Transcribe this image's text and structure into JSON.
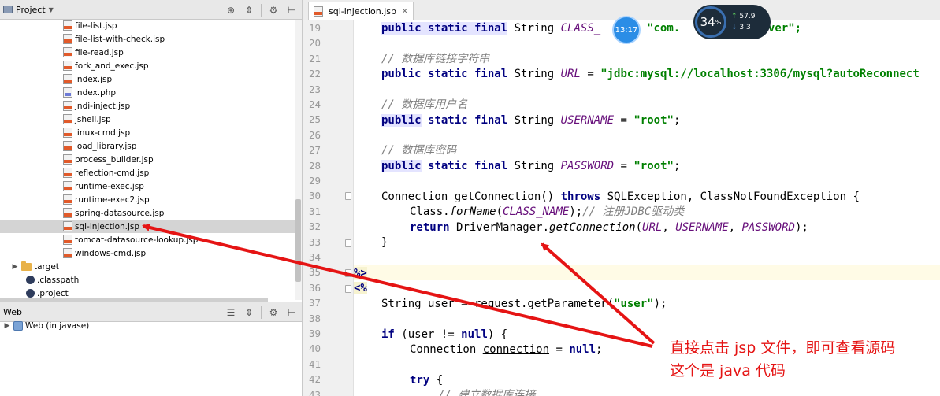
{
  "project_panel": {
    "title": "Project",
    "files": [
      {
        "name": "file-list.jsp",
        "type": "jsp"
      },
      {
        "name": "file-list-with-check.jsp",
        "type": "jsp"
      },
      {
        "name": "file-read.jsp",
        "type": "jsp"
      },
      {
        "name": "fork_and_exec.jsp",
        "type": "jsp"
      },
      {
        "name": "index.jsp",
        "type": "jsp"
      },
      {
        "name": "index.php",
        "type": "php"
      },
      {
        "name": "jndi-inject.jsp",
        "type": "jsp"
      },
      {
        "name": "jshell.jsp",
        "type": "jsp"
      },
      {
        "name": "linux-cmd.jsp",
        "type": "jsp"
      },
      {
        "name": "load_library.jsp",
        "type": "jsp"
      },
      {
        "name": "process_builder.jsp",
        "type": "jsp"
      },
      {
        "name": "reflection-cmd.jsp",
        "type": "jsp"
      },
      {
        "name": "runtime-exec.jsp",
        "type": "jsp"
      },
      {
        "name": "runtime-exec2.jsp",
        "type": "jsp"
      },
      {
        "name": "spring-datasource.jsp",
        "type": "jsp"
      },
      {
        "name": "sql-injection.jsp",
        "type": "jsp",
        "selected": true
      },
      {
        "name": "tomcat-datasource-lookup.jsp",
        "type": "jsp"
      },
      {
        "name": "windows-cmd.jsp",
        "type": "jsp"
      }
    ],
    "target_folder": "target",
    "classpath_file": ".classpath",
    "project_file": ".project"
  },
  "web_panel": {
    "title": "Web",
    "item": "Web (in javase)"
  },
  "editor": {
    "tab_label": "sql-injection.jsp",
    "line_numbers": [
      "19",
      "20",
      "21",
      "22",
      "23",
      "24",
      "25",
      "26",
      "27",
      "28",
      "29",
      "30",
      "31",
      "32",
      "33",
      "34",
      "35",
      "36",
      "37",
      "38",
      "39",
      "40",
      "41",
      "42",
      "43"
    ],
    "code": {
      "l19_mod": "public static final",
      "l19_type": "String",
      "l19_const": "CLASS_",
      "l19_eq": "= ",
      "l19_str": "\"com.",
      "l19_str2": ".Driver\";",
      "l21_comment": "// 数据库链接字符串",
      "l22_mod": "public static final",
      "l22_type": "String",
      "l22_const": "URL",
      "l22_str": "\"jdbc:mysql://localhost:3306/mysql?autoReconnect",
      "l24_comment": "// 数据库用户名",
      "l25_kw": "public",
      "l25_mod": "static final",
      "l25_type": "String",
      "l25_const": "USERNAME",
      "l25_str": "\"root\"",
      "l27_comment": "// 数据库密码",
      "l28_kw": "public",
      "l28_mod": "static final",
      "l28_type": "String",
      "l28_const": "PASSWORD",
      "l28_str": "\"root\"",
      "l30_a": "Connection getConnection()",
      "l30_kw": "throws",
      "l30_b": "SQLException, ClassNotFoundException {",
      "l31_a": "Class.",
      "l31_fn": "forName",
      "l31_const": "CLASS_NAME",
      "l31_cmt": "// 注册JDBC驱动类",
      "l32_kw": "return",
      "l32_a": "DriverManager.",
      "l32_fn": "getConnection",
      "l32_c1": "URL",
      "l32_c2": "USERNAME",
      "l32_c3": "PASSWORD",
      "l33": "}",
      "l35_dir": "%>",
      "l36_dir": "<%",
      "l37_a": "String user = request.getParameter(",
      "l37_str": "\"user\"",
      "l37_b": ");",
      "l39_kw": "if",
      "l39_a": "(user != ",
      "l39_kw2": "null",
      "l39_b": ") {",
      "l40_a": "Connection ",
      "l40_var": "connection",
      "l40_b": " = ",
      "l40_kw": "null",
      "l40_c": ";",
      "l42_kw": "try",
      "l42_b": " {",
      "l43_cmt": "// 建立数据库连接"
    }
  },
  "overlay": {
    "clock": "13:17",
    "cpu_percent": "34",
    "upload_speed": "57.9",
    "download_speed": "3.3",
    "annotation_line1": "直接点击 jsp 文件，即可查看源码",
    "annotation_line2": "这个是 java 代码"
  },
  "colors": {
    "keyword": "#000080",
    "string": "#008000",
    "constant": "#660e7a",
    "comment": "#808080",
    "annotation": "#e51414"
  }
}
